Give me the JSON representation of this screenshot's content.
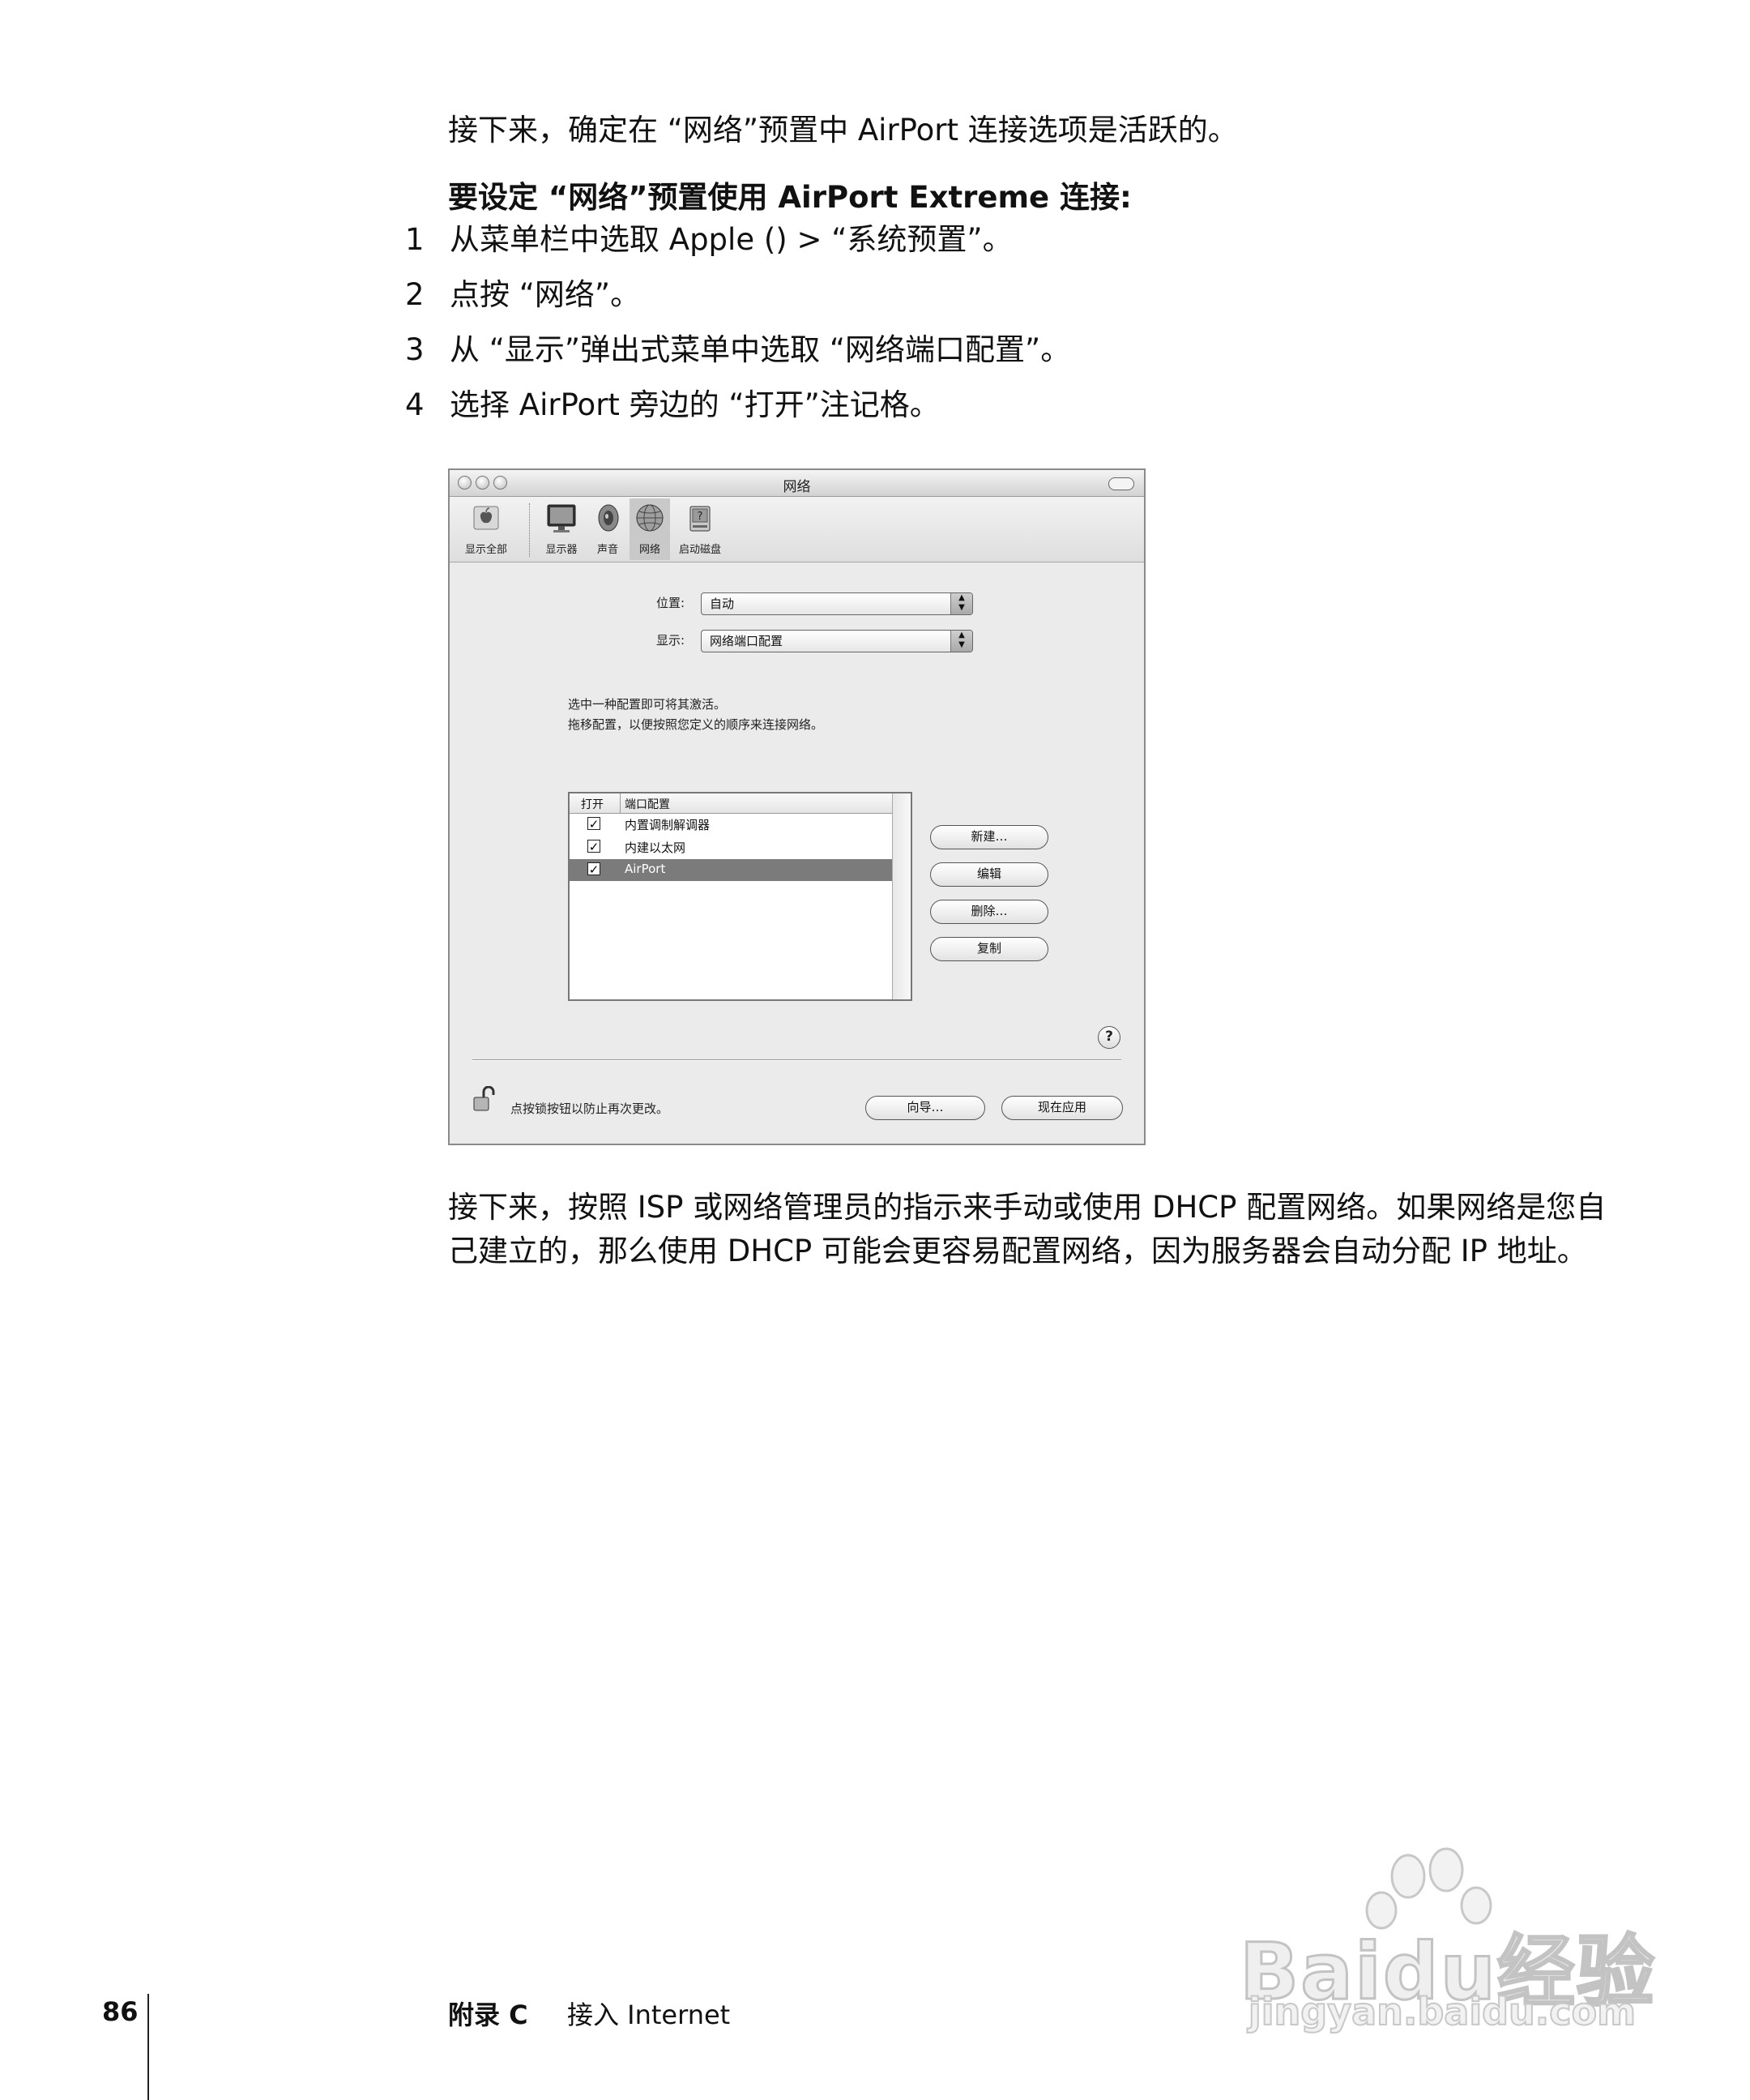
{
  "intro_para": "接下来，确定在 “网络”预置中 AirPort 连接选项是活跃的。",
  "section_heading": "要设定 “网络”预置使用 AirPort Extreme 连接:",
  "steps": [
    {
      "num": "1",
      "text": "从菜单栏中选取 Apple () > “系统预置”。"
    },
    {
      "num": "2",
      "text": "点按 “网络”。"
    },
    {
      "num": "3",
      "text": "从 “显示”弹出式菜单中选取 “网络端口配置”。"
    },
    {
      "num": "4",
      "text": "选择 AirPort 旁边的 “打开”注记格。"
    }
  ],
  "screenshot": {
    "window_title": "网络",
    "toolbar": [
      "显示全部",
      "显示器",
      "声音",
      "网络",
      "启动磁盘"
    ],
    "location_label": "位置:",
    "location_value": "自动",
    "show_label": "显示:",
    "show_value": "网络端口配置",
    "info_line1": "选中一种配置即可将其激活。",
    "info_line2": "拖移配置，以便按照您定义的顺序来连接网络。",
    "table_headers": {
      "on": "打开",
      "port": "端口配置"
    },
    "ports": [
      {
        "name": "内置调制解调器",
        "checked": true,
        "selected": false
      },
      {
        "name": "内建以太网",
        "checked": true,
        "selected": false
      },
      {
        "name": "AirPort",
        "checked": true,
        "selected": true
      }
    ],
    "buttons": {
      "new": "新建…",
      "edit": "编辑",
      "delete": "删除…",
      "duplicate": "复制"
    },
    "help": "?",
    "lock_text": "点按锁按钮以防止再次更改。",
    "assist_button": "向导…",
    "apply_button": "现在应用"
  },
  "after_para": "接下来，按照 ISP 或网络管理员的指示来手动或使用 DHCP 配置网络。如果网络是您自己建立的，那么使用 DHCP 可能会更容易配置网络，因为服务器会自动分配 IP 地址。",
  "footer": {
    "page_number": "86",
    "appendix": "附录 C",
    "chapter": "接入 Internet"
  },
  "watermark": {
    "brand": "Baidu经验",
    "url": "jingyan.baidu.com"
  }
}
